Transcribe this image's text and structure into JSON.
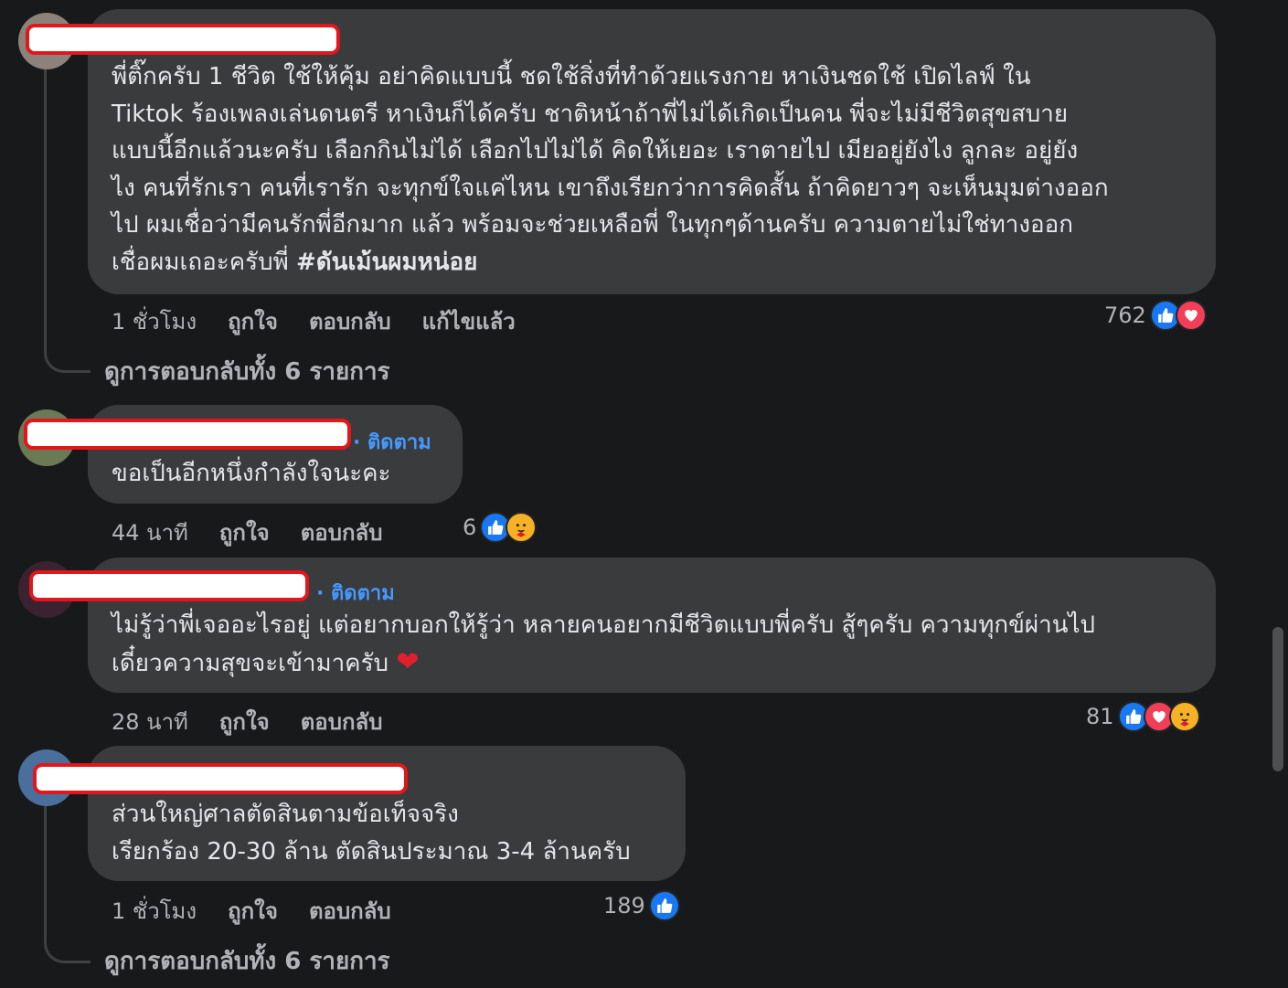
{
  "comments": [
    {
      "lines": [
        "พี่ติ๊กครับ 1 ชีวิต ใช้ให้คุ้ม อย่าคิดแบบนี้ ชดใช้สิ่งที่ทำด้วยแรงกาย หาเงินชดใช้ เปิดไลฟ์ ใน",
        "Tiktok ร้องเพลงเล่นดนตรี หาเงินก็ได้ครับ ชาติหน้าถ้าพี่ไม่ได้เกิดเป็นคน พี่จะไม่มีชีวิตสุขสบาย",
        "แบบนี้อีกแล้วนะครับ เลือกกินไม่ได้ เลือกไปไม่ได้ คิดให้เยอะ เราตายไป เมียอยู่ยังไง ลูกละ อยู่ยัง",
        "ไง คนที่รักเรา คนที่เรารัก จะทุกข์ใจแค่ไหน เขาถึงเรียกว่าการคิดสั้น ถ้าคิดยาวๆ จะเห็นมุมต่างออก",
        "ไป ผมเชื่อว่ามีคนรักพี่อีกมาก แล้ว พร้อมจะช่วยเหลือพี่ ในทุกๆด้านครับ ความตายไม่ใช่ทางออก",
        "เชื่อผมเถอะครับพี่ "
      ],
      "hashtag": "#ดันเม้นผมหน่อย",
      "time": "1 ชั่วโมง",
      "like": "ถูกใจ",
      "reply": "ตอบกลับ",
      "edited": "แก้ไขแล้ว",
      "count": "762",
      "view_replies": "ดูการตอบกลับทั้ง 6 รายการ"
    },
    {
      "follow": "· ติดตาม",
      "lines": [
        "ขอเป็นอีกหนึ่งกำลังใจนะคะ"
      ],
      "time": "44 นาที",
      "like": "ถูกใจ",
      "reply": "ตอบกลับ",
      "count": "6"
    },
    {
      "follow": "· ติดตาม",
      "lines": [
        "ไม่รู้ว่าพี่เจออะไรอยู่ แต่อยากบอกให้รู้ว่า หลายคนอยากมีชีวิตแบบพี่ครับ สู้ๆครับ ความทุกข์ผ่านไป",
        "เดี๋ยวความสุขจะเข้ามาครับ "
      ],
      "emoji": "❤",
      "time": "28 นาที",
      "like": "ถูกใจ",
      "reply": "ตอบกลับ",
      "count": "81"
    },
    {
      "lines": [
        "ส่วนใหญ่ศาลตัดสินตามข้อเท็จจริง",
        "เรียกร้อง 20-30 ล้าน ตัดสินประมาณ 3-4 ล้านครับ"
      ],
      "time": "1 ชั่วโมง",
      "like": "ถูกใจ",
      "reply": "ตอบกลับ",
      "count": "189",
      "view_replies": "ดูการตอบกลับทั้ง 6 รายการ"
    }
  ],
  "reaction_icons": {
    "like": "thumbs-up-icon",
    "love": "heart-icon",
    "care": "care-hug-icon"
  },
  "colors": {
    "background": "#18191a",
    "bubble": "#3a3b3c",
    "text": "#e4e6eb",
    "secondary": "#b0b3b8",
    "link": "#4599ff",
    "like": "#1877f2",
    "love": "#f33e58",
    "care": "#f7b125",
    "redaction": "#e3161b"
  }
}
